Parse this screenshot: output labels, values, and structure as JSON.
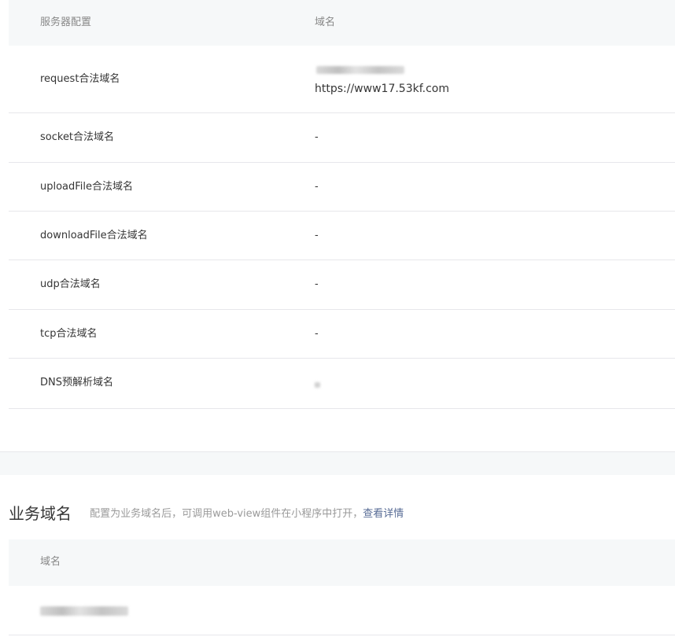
{
  "server_config_table": {
    "header": {
      "col_config": "服务器配置",
      "col_domain": "域名"
    },
    "rows": [
      {
        "label": "request合法域名",
        "value": "https://www17.53kf.com",
        "has_redacted_line": true
      },
      {
        "label": "socket合法域名",
        "value": "-"
      },
      {
        "label": "uploadFile合法域名",
        "value": "-"
      },
      {
        "label": "downloadFile合法域名",
        "value": "-"
      },
      {
        "label": "udp合法域名",
        "value": "-"
      },
      {
        "label": "tcp合法域名",
        "value": "-"
      },
      {
        "label": "DNS预解析域名",
        "value": "",
        "redacted": true
      }
    ]
  },
  "business_domain": {
    "title": "业务域名",
    "description": "配置为业务域名后，可调用web-view组件在小程序中打开，",
    "link_label": "查看详情",
    "table": {
      "header": {
        "col_domain": "域名"
      },
      "rows": [
        {
          "value": "",
          "redacted": true
        }
      ]
    }
  }
}
